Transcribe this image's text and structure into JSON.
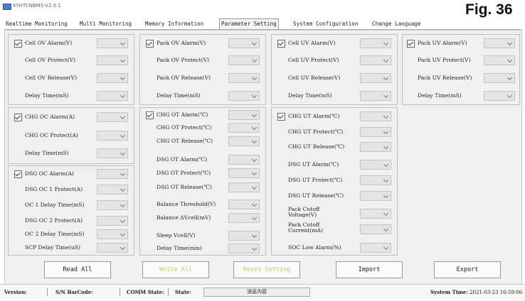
{
  "window": {
    "title": "KYHTCNBMS-V2.0.1"
  },
  "figure_label": "Fig. 36",
  "tabs": [
    "Realtime Monitoring",
    "Multi Monitoring",
    "Memory Information",
    "Parameter Setting",
    "System Configuration",
    "Change Language"
  ],
  "active_tab": "Parameter Setting",
  "groups": {
    "cell_ov": {
      "alarm": "Cell OV Alarm(V)",
      "protect": "Cell OV Protect(V)",
      "release": "Cell OV Release(V)",
      "delay": "Delay Time(mS)"
    },
    "pack_ov": {
      "alarm": "Pack OV Alarm(V)",
      "protect": "Pack OV Protect(V)",
      "release": "Pack OV Release(V)",
      "delay": "Delay Time(mS)"
    },
    "cell_uv": {
      "alarm": "Cell UV Alarm(V)",
      "protect": "Cell UV Protect(V)",
      "release": "Cell UV Release(V)",
      "delay": "Delay Time(mS)"
    },
    "pack_uv": {
      "alarm": "Pack UV Alarm(V)",
      "protect": "Pack UV Protect(V)",
      "release": "Pack UV Release(V)",
      "delay": "Delay Time(mS)"
    },
    "chg_oc": {
      "alarm": "CHG OC Alarm(A)",
      "protect": "CHG OC Protect(A)",
      "delay": "Delay Time(mS)"
    },
    "dsg_oc": {
      "alarm": "DSG OC Alarm(A)",
      "oc1_protect": "DSG OC 1 Protect(A)",
      "oc1_delay": "OC 1 Delay Time(mS)",
      "oc2_protect": "DSG OC 2 Protect(A)",
      "oc2_delay": "OC 2 Delay Time(mS)",
      "scp_delay": "SCP Delay Time(uS)"
    },
    "ot": {
      "chg_alarm": "CHG OT Alarm(℃)",
      "chg_protect": "CHG OT Protect(℃)",
      "chg_release": "CHG OT Release(℃)",
      "dsg_alarm": "DSG OT Alarm(℃)",
      "dsg_protect": "DSG OT Protect(℃)",
      "dsg_release": "DSG OT Release(℃)",
      "balance_threshold": "Balance Threshold(V)",
      "balance_dvcell": "Balance ΔVcell(mV)",
      "sleep_vcell": "Sleep Vcell(V)",
      "delay": "Delay Time(min)"
    },
    "ut": {
      "chg_alarm": "CHG UT Alarm(℃)",
      "chg_protect": "CHG UT Protect(℃)",
      "chg_release": "CHG UT Release(℃)",
      "dsg_alarm": "DSG UT Alarm(℃)",
      "dsg_protect": "DSG UT Protect(℃)",
      "dsg_release": "DSG UT Release(℃)",
      "pack_cutoff_voltage": "Pack Cutoff Voltage(V)",
      "pack_cutoff_current": "Pack Cutoff Current(mA)",
      "soc_low_alarm": "SOC Low Alarm(%)"
    }
  },
  "buttons": {
    "read_all": "Read All",
    "write_all": "Write All",
    "reset_setting": "Reset Setting",
    "import": "Import",
    "export": "Export"
  },
  "status": {
    "version_label": "Version:",
    "barcode_label": "S/N BarCode:",
    "comm_label": "COMM State:",
    "state_label": "State:",
    "state_message": "消息内容",
    "time_label": "System Time:",
    "time_value": "2021-03-23 16:59:06"
  },
  "colors": {
    "panel_bg": "#f0f0f0",
    "disabled_button_text": "#c8c85a"
  }
}
